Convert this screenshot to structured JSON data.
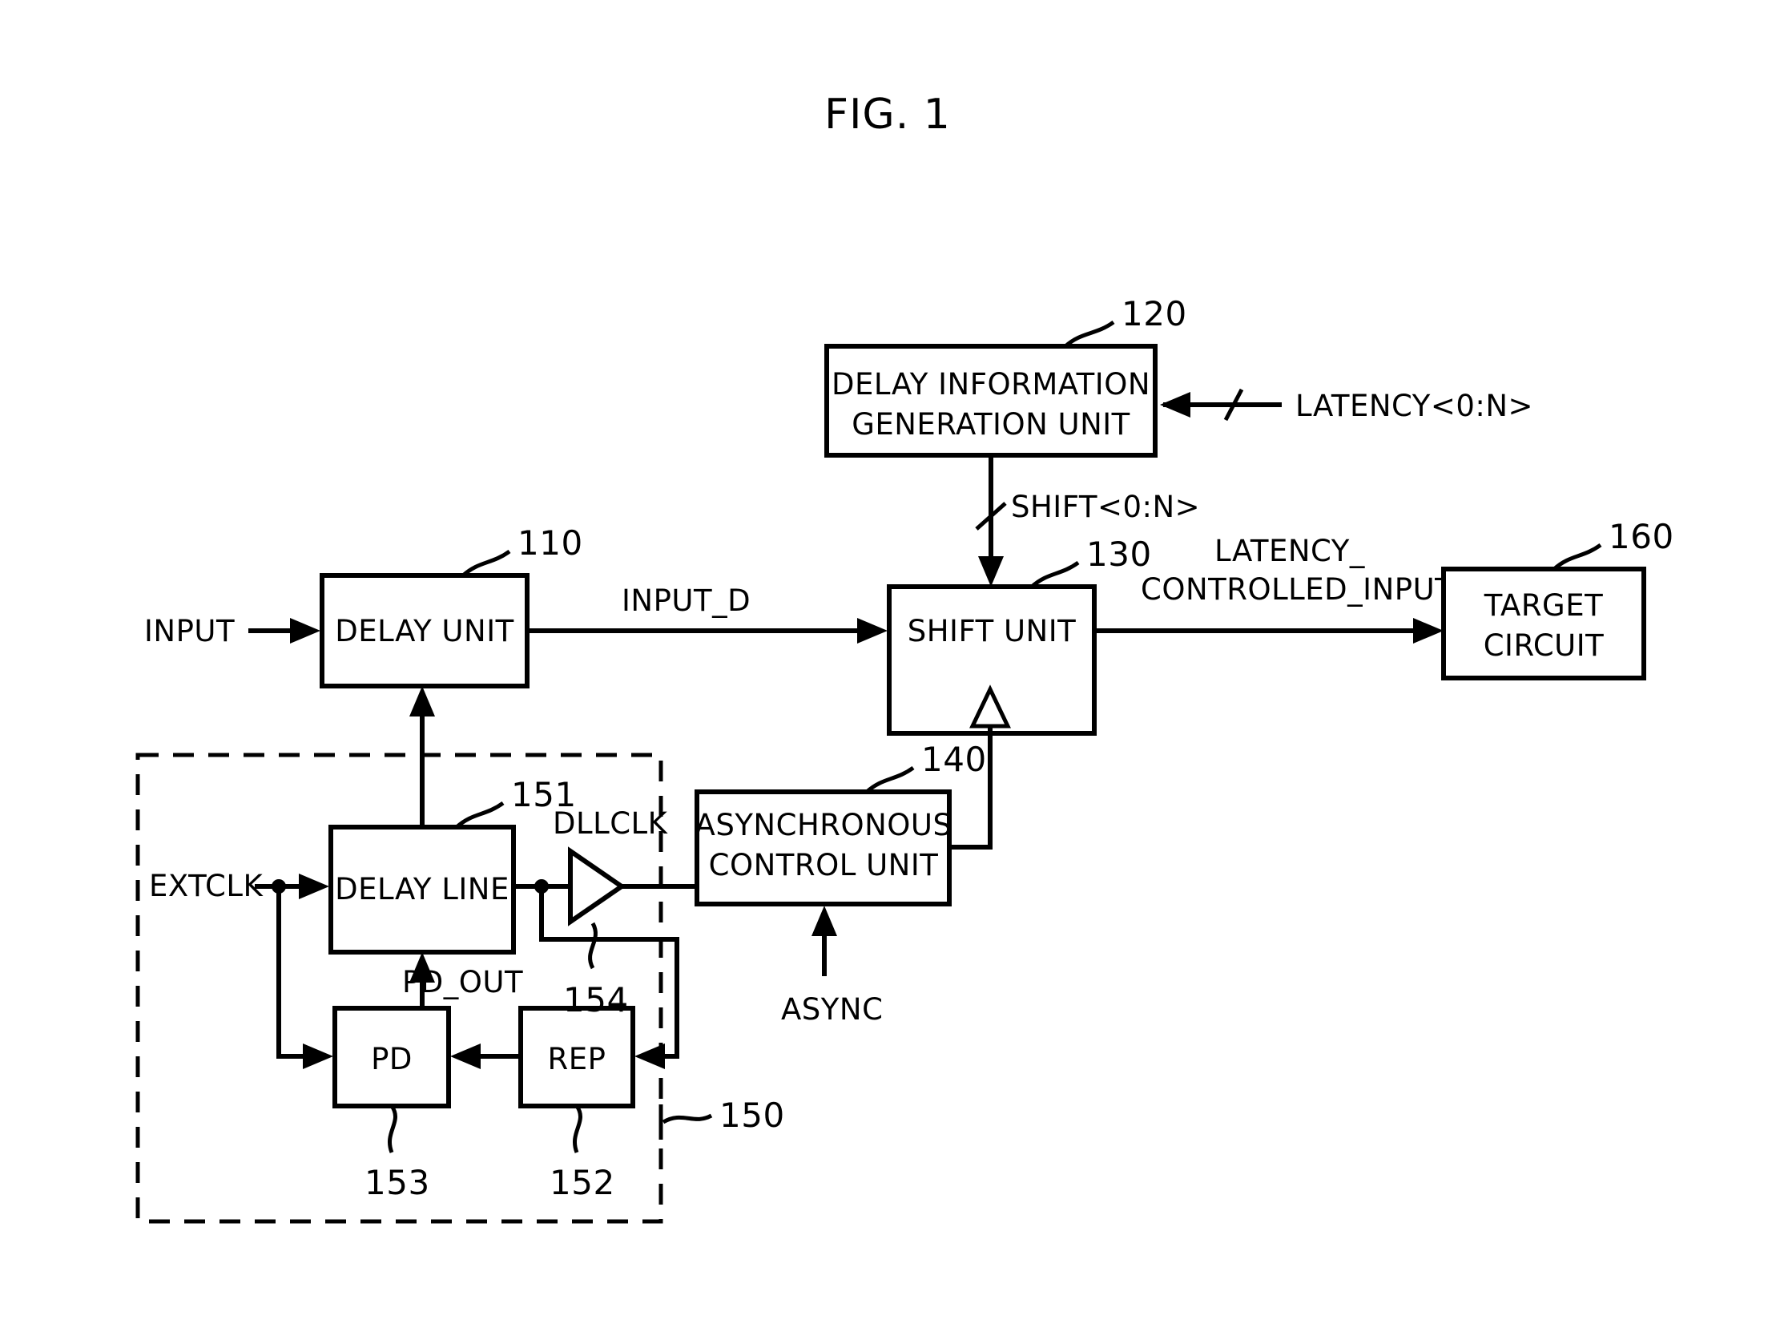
{
  "figure": {
    "title": "FIG. 1"
  },
  "blocks": [
    {
      "id": "delay_unit",
      "label": "DELAY UNIT",
      "ref": "110"
    },
    {
      "id": "delay_info_gen",
      "label_line1": "DELAY INFORMATION",
      "label_line2": "GENERATION UNIT",
      "ref": "120"
    },
    {
      "id": "shift_unit",
      "label": "SHIFT UNIT",
      "ref": "130"
    },
    {
      "id": "async_control",
      "label_line1": "ASYNCHRONOUS",
      "label_line2": "CONTROL UNIT",
      "ref": "140"
    },
    {
      "id": "dll",
      "label": "",
      "ref": "150"
    },
    {
      "id": "delay_line",
      "label": "DELAY LINE",
      "ref": "151"
    },
    {
      "id": "rep",
      "label": "REP",
      "ref": "152"
    },
    {
      "id": "pd",
      "label": "PD",
      "ref": "153"
    },
    {
      "id": "buffer",
      "label": "",
      "ref": "154"
    },
    {
      "id": "target_circuit",
      "label_line1": "TARGET",
      "label_line2": "CIRCUIT",
      "ref": "160"
    }
  ],
  "signals": {
    "input": "INPUT",
    "input_d": "INPUT_D",
    "latency": "LATENCY<0:N>",
    "shift": "SHIFT<0:N>",
    "latency_controlled_input_line1": "LATENCY_",
    "latency_controlled_input_line2": "CONTROLLED_INPUT",
    "extclk": "EXTCLK",
    "dllclk": "DLLCLK",
    "pd_out": "PD_OUT",
    "async": "ASYNC"
  }
}
